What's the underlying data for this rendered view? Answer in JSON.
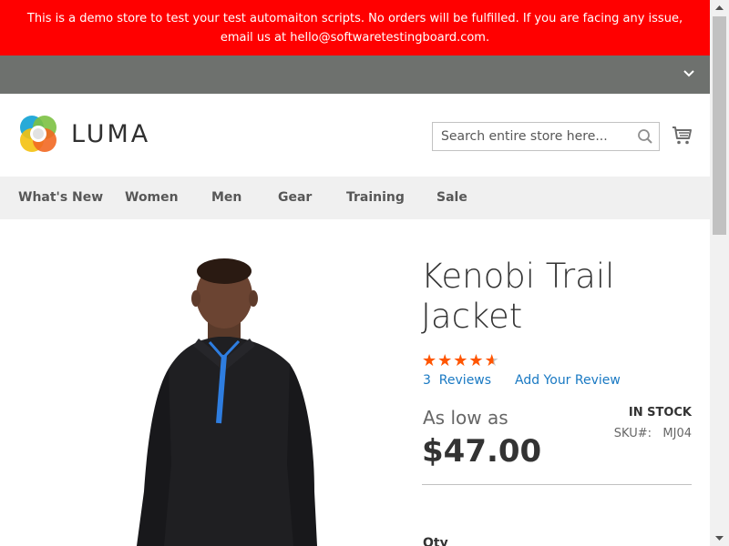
{
  "demo_banner": {
    "text": "This is a demo store to test your test automaiton scripts. No orders will be fulfilled. If you are facing any issue, email us at hello@softwaretestingboard.com."
  },
  "header": {
    "logo_text": "LUMA",
    "search_placeholder": "Search entire store here...",
    "search_icon": "search-icon",
    "cart_icon": "cart-icon"
  },
  "nav": {
    "items": [
      {
        "label": "What's New"
      },
      {
        "label": "Women"
      },
      {
        "label": "Men"
      },
      {
        "label": "Gear"
      },
      {
        "label": "Training"
      },
      {
        "label": "Sale"
      }
    ]
  },
  "product": {
    "title_line1": "Kenobi Trail",
    "title_line2": "Jacket",
    "rating": 4.6,
    "rating_max": 5,
    "reviews_label": "3  Reviews",
    "add_review_label": "Add Your Review",
    "price_prefix": "As low as",
    "price": "$47.00",
    "stock": "IN STOCK",
    "sku": "SKU#:   MJ04",
    "qty_label": "Qty"
  },
  "colors": {
    "banner": "#ff0000",
    "panel": "#6e716e",
    "nav_bg": "#f0f0f0",
    "link": "#1979c3",
    "star": "#ff5501"
  }
}
